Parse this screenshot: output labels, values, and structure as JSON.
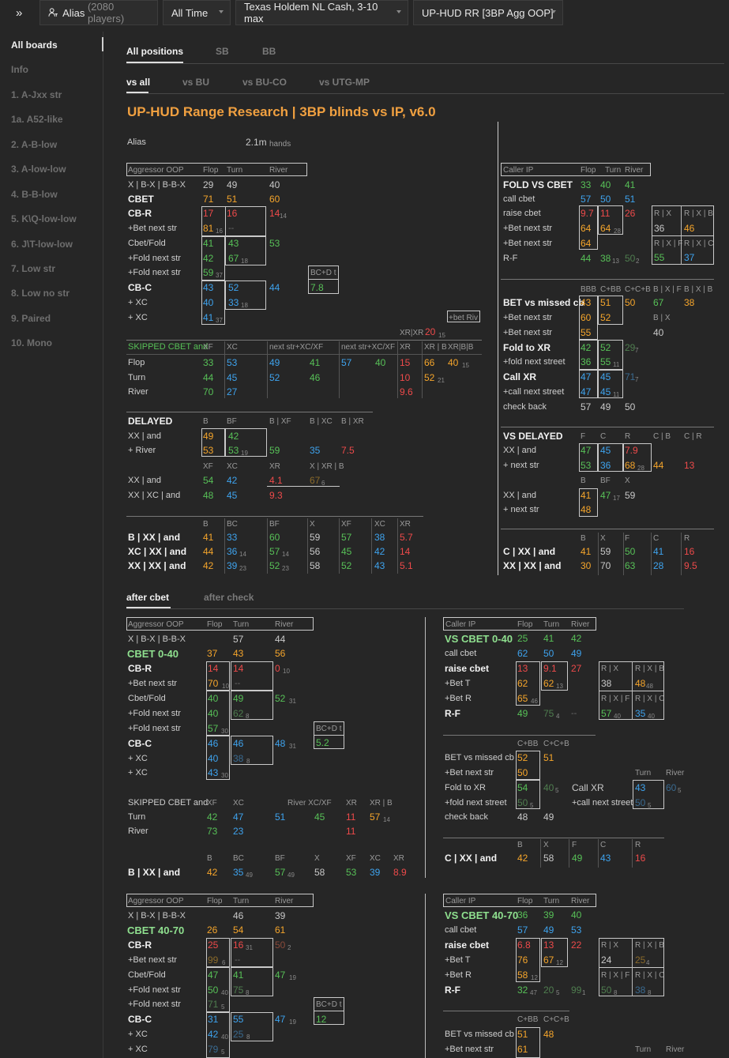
{
  "topbar": {
    "expand": "»",
    "alias": "Alias",
    "players": "(2080 players)",
    "time": "All Time",
    "game": "Texas Holdem NL Cash, 3-10 max",
    "report": "UP-HUD RR [3BP Agg OOP]"
  },
  "sidebar": {
    "items": [
      "All boards",
      "Info",
      "1. A-Jxx str",
      "1a. A52-like",
      "2. A-B-low",
      "3. A-low-low",
      "4. B-B-low",
      "5. K\\Q-low-low",
      "6. J\\T-low-low",
      "7. Low str",
      "8. Low no str",
      "9. Paired",
      "10. Mono"
    ]
  },
  "tabs": {
    "positions": [
      "All positions",
      "SB",
      "BB"
    ],
    "vs": [
      "vs all",
      "vs BU",
      "vs BU-CO",
      "vs UTG-MP"
    ],
    "after": [
      "after cbet",
      "after check"
    ]
  },
  "title": "UP-HUD Range Research | 3BP blinds vs IP, v6.0",
  "alias_row": {
    "label": "Alias",
    "hands": "2.1m",
    "unit": "hands"
  },
  "colors": {
    "orange": "#f5a52b",
    "green": "#57c057",
    "blue": "#3ea3ee",
    "red": "#ee4a4a",
    "title": "#f0a040"
  },
  "sec1": {
    "agg_hdr": [
      "Aggressor OOP",
      "Flop",
      "Turn",
      "River"
    ],
    "x_bx": [
      "X | B-X | B-B-X",
      "29",
      "49",
      "40"
    ],
    "cbet": [
      "CBET",
      "71",
      "51",
      "60"
    ],
    "cbr": [
      "CB-R",
      "17",
      "16",
      "14",
      "14"
    ],
    "bet_next": [
      "+Bet next str",
      "81",
      "16",
      "--"
    ],
    "cbet_fold": [
      "Cbet/Fold",
      "41",
      "43",
      "53"
    ],
    "fold_next1": [
      "+Fold next str",
      "42",
      "67",
      "18"
    ],
    "fold_next2": [
      "+Fold next str",
      "59",
      "37"
    ],
    "bcd": [
      "BC+D t",
      "7.8"
    ],
    "cbc": [
      "CB-C",
      "43",
      "52",
      "44"
    ],
    "xc": [
      "+ XC",
      "40",
      "33",
      "18"
    ],
    "xc2": [
      "+ XC",
      "41",
      "37"
    ],
    "betriv": "+bet Riv",
    "xrxr": [
      "XR|XR",
      "20",
      "15"
    ],
    "skip_hdr": [
      "SKIPPED CBET and",
      "XF",
      "XC",
      "next str+XC/XF",
      "next str+XC/XF",
      "XR",
      "XR | B",
      "XR|B|B"
    ],
    "skip_flop": [
      "Flop",
      "33",
      "53",
      "49",
      "41",
      "57",
      "40",
      "15",
      "66",
      "40",
      "15"
    ],
    "skip_turn": [
      "Turn",
      "44",
      "45",
      "52",
      "46",
      "10",
      "52",
      "21"
    ],
    "skip_river": [
      "River",
      "70",
      "27",
      "9.6"
    ],
    "del_hdr": [
      "DELAYED",
      "B",
      "BF",
      "B | XF",
      "B | XC",
      "B | XR"
    ],
    "del_xx": [
      "XX | and",
      "49",
      "42"
    ],
    "del_river": [
      "+ River",
      "53",
      "53",
      "19",
      "59",
      "35",
      "7.5"
    ],
    "del_hdr2": [
      "XF",
      "XC",
      "XR",
      "X | XR | B"
    ],
    "del_xx2": [
      "XX | and",
      "54",
      "42",
      "4.1",
      "67",
      "6"
    ],
    "del_xxxc": [
      "XX | XC | and",
      "48",
      "45",
      "9.3"
    ],
    "bx_hdr": [
      "B",
      "BC",
      "BF",
      "X",
      "XF",
      "XC",
      "XR"
    ],
    "bxx": [
      "B | XX | and",
      "41",
      "33",
      "60",
      "59",
      "57",
      "38",
      "5.7"
    ],
    "xcxx": [
      "XC | XX | and",
      "44",
      "36",
      "14",
      "57",
      "14",
      "56",
      "45",
      "42",
      "14"
    ],
    "xxxx": [
      "XX | XX | and",
      "42",
      "39",
      "23",
      "52",
      "23",
      "58",
      "52",
      "43",
      "5.1"
    ],
    "call_hdr": [
      "Caller IP",
      "Flop",
      "Turn",
      "River"
    ],
    "fold_vs": [
      "FOLD VS CBET",
      "33",
      "40",
      "41"
    ],
    "call_cbet": [
      "call cbet",
      "57",
      "50",
      "51"
    ],
    "raise_cbet": [
      "raise cbet",
      "9.7",
      "11",
      "26"
    ],
    "rx_hdr": [
      "R | X",
      "R | X | B",
      "36",
      "46",
      "R | X | F",
      "R | X | C",
      "55",
      "37"
    ],
    "bet_next_ip": [
      "+Bet next str",
      "64",
      "64",
      "28"
    ],
    "bet_next_ip2": [
      "+Bet next str",
      "64"
    ],
    "rf": [
      "R-F",
      "44",
      "38",
      "13",
      "50",
      "2"
    ],
    "miss_hdr": [
      "BBB",
      "C+BB",
      "C+C+B",
      "B | X | F",
      "B | X | B"
    ],
    "miss": [
      "BET vs missed cb",
      "43",
      "51",
      "50",
      "67",
      "38"
    ],
    "miss_b1": [
      "+Bet next str",
      "60",
      "52",
      "B | X"
    ],
    "miss_b2": [
      "+Bet next str",
      "55",
      "40"
    ],
    "fxr": [
      "Fold to XR",
      "42",
      "52",
      "29",
      "7"
    ],
    "fnext": [
      "+fold next street",
      "36",
      "55",
      "11"
    ],
    "cxr": [
      "Call XR",
      "47",
      "45",
      "71",
      "7"
    ],
    "cnext": [
      "+call next street",
      "47",
      "45",
      "11"
    ],
    "checkback": [
      "check back",
      "57",
      "49",
      "50"
    ],
    "vsdel_hdr": [
      "VS DELAYED",
      "F",
      "C",
      "R",
      "C | B",
      "C | R"
    ],
    "vsdel_xx": [
      "XX | and",
      "47",
      "45",
      "7.9"
    ],
    "vsdel_next": [
      "+ next str",
      "53",
      "36",
      "68",
      "28",
      "44",
      "13"
    ],
    "vsdel_hdr2": [
      "B",
      "BF",
      "X"
    ],
    "vsdel_xx2": [
      "XX | and",
      "41",
      "47",
      "17",
      "59"
    ],
    "vsdel_next2": [
      "+ next str",
      "48"
    ],
    "cxx_hdr": [
      "B",
      "X",
      "F",
      "C",
      "R"
    ],
    "cxx": [
      "C | XX | and",
      "41",
      "59",
      "50",
      "41",
      "16"
    ],
    "xxxx_ip": [
      "XX | XX | and",
      "30",
      "70",
      "63",
      "28",
      "9.5"
    ]
  },
  "sec2": {
    "agg_hdr": [
      "Aggressor OOP",
      "Flop",
      "Turn",
      "River"
    ],
    "x_bx": [
      "X | B-X | B-B-X",
      "57",
      "44"
    ],
    "cbet": [
      "CBET 0-40",
      "37",
      "43",
      "56"
    ],
    "cbr": [
      "CB-R",
      "14",
      "14",
      "0",
      "10"
    ],
    "bet_next": [
      "+Bet next str",
      "70",
      "10",
      "--"
    ],
    "cbet_fold": [
      "Cbet/Fold",
      "40",
      "49",
      "52",
      "31"
    ],
    "fold_next1": [
      "+Fold next str",
      "40",
      "62",
      "8"
    ],
    "fold_next2": [
      "+Fold next str",
      "57",
      "30"
    ],
    "bcd": [
      "BC+D t",
      "5.2"
    ],
    "cbc": [
      "CB-C",
      "46",
      "46",
      "48",
      "31"
    ],
    "xc": [
      "+ XC",
      "40",
      "38",
      "8"
    ],
    "xc2": [
      "+ XC",
      "43",
      "30"
    ],
    "skip_hdr": [
      "SKIPPED CBET and",
      "XF",
      "XC",
      "River XC/XF",
      "XR",
      "XR | B"
    ],
    "skip_turn": [
      "Turn",
      "42",
      "47",
      "51",
      "45",
      "11",
      "57",
      "14"
    ],
    "skip_river": [
      "River",
      "73",
      "23",
      "11"
    ],
    "bx_hdr": [
      "B",
      "BC",
      "BF",
      "X",
      "XF",
      "XC",
      "XR"
    ],
    "bxx": [
      "B | XX | and",
      "42",
      "35",
      "49",
      "57",
      "49",
      "58",
      "53",
      "39",
      "8.9"
    ],
    "call_hdr": [
      "Caller IP",
      "Flop",
      "Turn",
      "River"
    ],
    "vs": [
      "VS CBET 0-40",
      "25",
      "41",
      "42"
    ],
    "call_cbet": [
      "call cbet",
      "62",
      "50",
      "49"
    ],
    "raise_cbet": [
      "raise cbet",
      "13",
      "9.1",
      "27"
    ],
    "rx_hdr": [
      "R | X",
      "R | X | B",
      "38",
      "48",
      "48",
      "R | X | F",
      "R | X | C",
      "57",
      "40",
      "35",
      "40"
    ],
    "bet_t": [
      "+Bet T",
      "62",
      "62",
      "13"
    ],
    "bet_r": [
      "+Bet R",
      "65",
      "46"
    ],
    "rf": [
      "R-F",
      "49",
      "75",
      "4",
      "--"
    ],
    "miss_hdr": [
      "C+BB",
      "C+C+B"
    ],
    "miss": [
      "BET vs missed cb",
      "52",
      "51"
    ],
    "miss_b1": [
      "+Bet next str",
      "50"
    ],
    "fxr": [
      "Fold to XR",
      "54",
      "40",
      "5"
    ],
    "fnext": [
      "+fold next street",
      "50",
      "5"
    ],
    "cxr": [
      "Call XR",
      "43",
      "60",
      "5"
    ],
    "cnext": [
      "+call next street",
      "50",
      "5"
    ],
    "turn_river": [
      "Turn",
      "River"
    ],
    "checkback": [
      "check back",
      "48",
      "49"
    ],
    "cxx_hdr": [
      "B",
      "X",
      "F",
      "C",
      "R"
    ],
    "cxx": [
      "C | XX | and",
      "42",
      "58",
      "49",
      "43",
      "16"
    ]
  },
  "sec3": {
    "agg_hdr": [
      "Aggressor OOP",
      "Flop",
      "Turn",
      "River"
    ],
    "x_bx": [
      "X | B-X | B-B-X",
      "46",
      "39"
    ],
    "cbet": [
      "CBET 40-70",
      "26",
      "54",
      "61"
    ],
    "cbr": [
      "CB-R",
      "25",
      "16",
      "31",
      "50",
      "2"
    ],
    "bet_next": [
      "+Bet next str",
      "99",
      "6",
      "--"
    ],
    "cbet_fold": [
      "Cbet/Fold",
      "47",
      "41",
      "47",
      "19"
    ],
    "fold_next1": [
      "+Fold next str",
      "50",
      "40",
      "75",
      "8"
    ],
    "fold_next2": [
      "+Fold next str",
      "71",
      "5"
    ],
    "bcd": [
      "BC+D t",
      "12"
    ],
    "cbc": [
      "CB-C",
      "31",
      "55",
      "47",
      "19"
    ],
    "xc": [
      "+ XC",
      "42",
      "40",
      "25",
      "8"
    ],
    "xc2": [
      "+ XC",
      "79",
      "5"
    ],
    "call_hdr": [
      "Caller IP",
      "Flop",
      "Turn",
      "River"
    ],
    "vs": [
      "VS CBET 40-70",
      "36",
      "39",
      "40"
    ],
    "call_cbet": [
      "call cbet",
      "57",
      "49",
      "53"
    ],
    "raise_cbet": [
      "raise cbet",
      "6.8",
      "13",
      "22"
    ],
    "rx_hdr": [
      "R | X",
      "R | X | B",
      "24",
      "25",
      "4",
      "R | X | F",
      "R | X | C",
      "50",
      "8",
      "38",
      "8"
    ],
    "bet_t": [
      "+Bet T",
      "76",
      "67",
      "12"
    ],
    "bet_r": [
      "+Bet R",
      "58",
      "12"
    ],
    "rf": [
      "R-F",
      "32",
      "47",
      "20",
      "5",
      "99",
      "1"
    ],
    "miss_hdr": [
      "C+BB",
      "C+C+B"
    ],
    "miss": [
      "BET vs missed cb",
      "51",
      "48"
    ],
    "miss_b1": [
      "+Bet next str",
      "61"
    ],
    "turn_river": [
      "Turn",
      "River"
    ]
  }
}
